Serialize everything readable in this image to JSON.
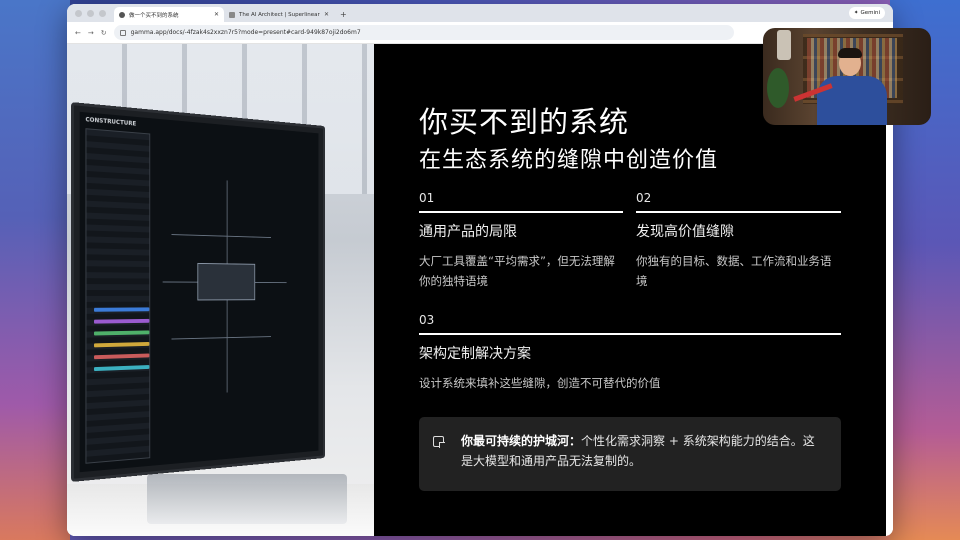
{
  "browser": {
    "tabs": [
      {
        "title": "做一个买不到的系统",
        "active": true
      },
      {
        "title": "The AI Architect | Superlinear",
        "active": false
      }
    ],
    "new_tab": "+",
    "gemini_label": "Gemini",
    "url": "gamma.app/docs/-4fzak4s2xxzn7r5?mode=present#card-949k87oji2do6m7"
  },
  "slide": {
    "title": "你买不到的系统",
    "subtitle": "在生态系统的缝隙中创造价值",
    "items": [
      {
        "num": "01",
        "title": "通用产品的局限",
        "desc": "大厂工具覆盖“平均需求”，但无法理解你的独特语境"
      },
      {
        "num": "02",
        "title": "发现高价值缝隙",
        "desc": "你独有的目标、数据、工作流和业务语境"
      },
      {
        "num": "03",
        "title": "架构定制解决方案",
        "desc": "设计系统来填补这些缝隙，创造不可替代的价值"
      }
    ],
    "callout": {
      "bold": "你最可持续的护城河：",
      "text": "个性化需求洞察 + 系统架构能力的结合。这是大模型和通用产品无法复制的。"
    },
    "image_screen_title": "CONSTRUCTURE"
  }
}
